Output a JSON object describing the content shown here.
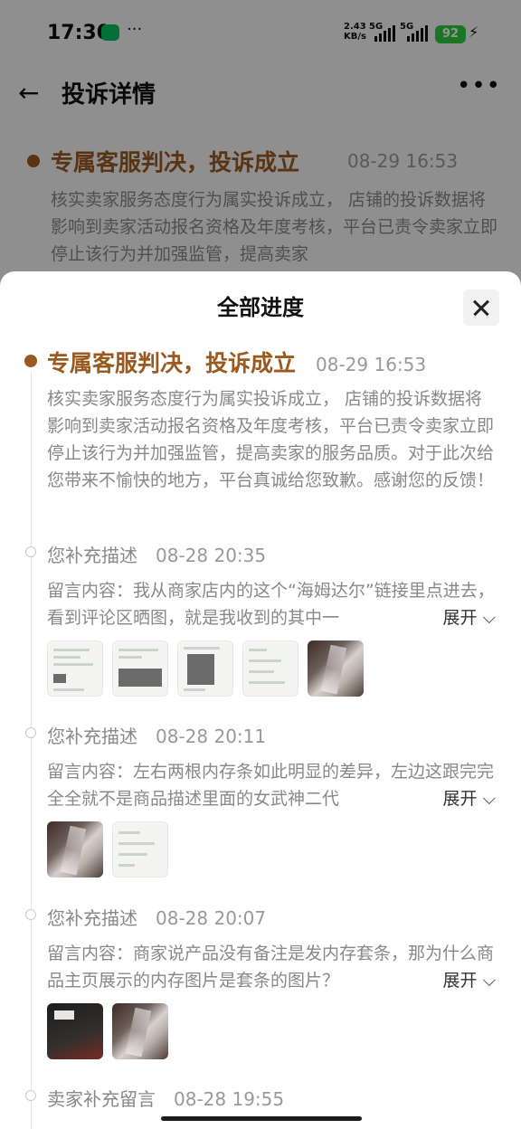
{
  "status_bar": {
    "time": "17:30",
    "net_speed": "2.43",
    "net_unit": "KB/s",
    "sig1": "5G",
    "sig2": "5G",
    "battery": "92"
  },
  "header": {
    "title": "投诉详情",
    "back_icon": "arrow-left-icon",
    "more_icon": "more-icon"
  },
  "background_entry": {
    "title": "专属客服判决，投诉成立",
    "time": "08-29 16:53",
    "body": "核实卖家服务态度行为属实投诉成立， 店铺的投诉数据将影响到卖家活动报名资格及年度考核，平台已责令卖家立即停止该行为并加强监管，提高卖家"
  },
  "sheet": {
    "title": "全部进度",
    "close_icon": "close-icon",
    "expand_label": "展开",
    "entries": [
      {
        "label": "专属客服判决，投诉成立",
        "time": "08-29 16:53",
        "content": "核实卖家服务态度行为属实投诉成立， 店铺的投诉数据将影响到卖家活动报名资格及年度考核，平台已责令卖家立即停止该行为并加强监管，提高卖家的服务品质。对于此次给您带来不愉快的地方，平台真诚给您致歉。感谢您的反馈！"
      },
      {
        "label": "您补充描述",
        "time": "08-28 20:35",
        "content": "留言内容：我从商家店内的这个“海姆达尔”链接里点进去，看到评论区晒图，就是我收到的其中一"
      },
      {
        "label": "您补充描述",
        "time": "08-28 20:11",
        "content": "留言内容：左右两根内存条如此明显的差异，左边这跟完完全全就不是商品描述里面的女武神二代"
      },
      {
        "label": "您补充描述",
        "time": "08-28 20:07",
        "content": "留言内容：商家说产品没有备注是发内存套条，那为什么商品主页展示的内存图片是套条的图片？"
      },
      {
        "label": "卖家补充留言",
        "time": "08-28 19:55"
      }
    ]
  },
  "colors": {
    "accent": "#9a5a1f",
    "muted_text": "#888888",
    "battery": "#2ecc40"
  }
}
